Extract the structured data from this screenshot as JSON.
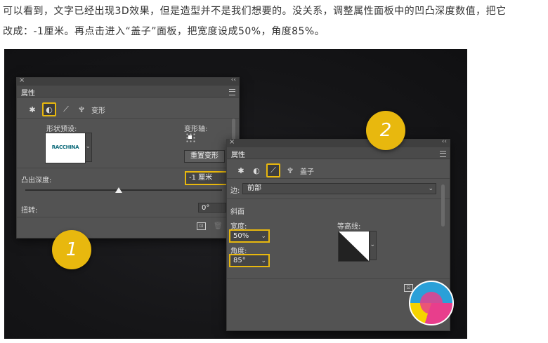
{
  "caption": {
    "line1": "可以看到，文字已经出现3D效果，但是造型并不是我们想要的。没关系，调整属性面板中的凹凸深度数值，把它",
    "line2": "改成：-1厘米。再点击进入“盖子”面板，把宽度设成50%，角度85%。"
  },
  "panel1": {
    "close": "×",
    "collapse": "‹‹",
    "title": "属性",
    "tab_label": "变形",
    "shape_preset_label": "形状预设:",
    "thumb_text": "RACCHINA",
    "transform_axis_label": "变形轴:",
    "reset_button": "重置变形",
    "depth_label": "凸出深度:",
    "depth_value": "-1 厘米",
    "twist_label": "扭转:",
    "twist_value": "0°"
  },
  "panel2": {
    "close": "×",
    "collapse": "‹‹",
    "title": "属性",
    "tab_label": "盖子",
    "side_label": "边:",
    "side_value": "前部",
    "bevel_label": "斜面",
    "width_label": "宽度:",
    "width_value": "50%",
    "angle_label": "角度:",
    "angle_value": "85°",
    "contour_label": "等高线:"
  },
  "badges": {
    "one": "1",
    "two": "2"
  },
  "colors": {
    "highlight": "#e8b80e",
    "panel_bg": "#535353",
    "canvas": "#151517"
  }
}
